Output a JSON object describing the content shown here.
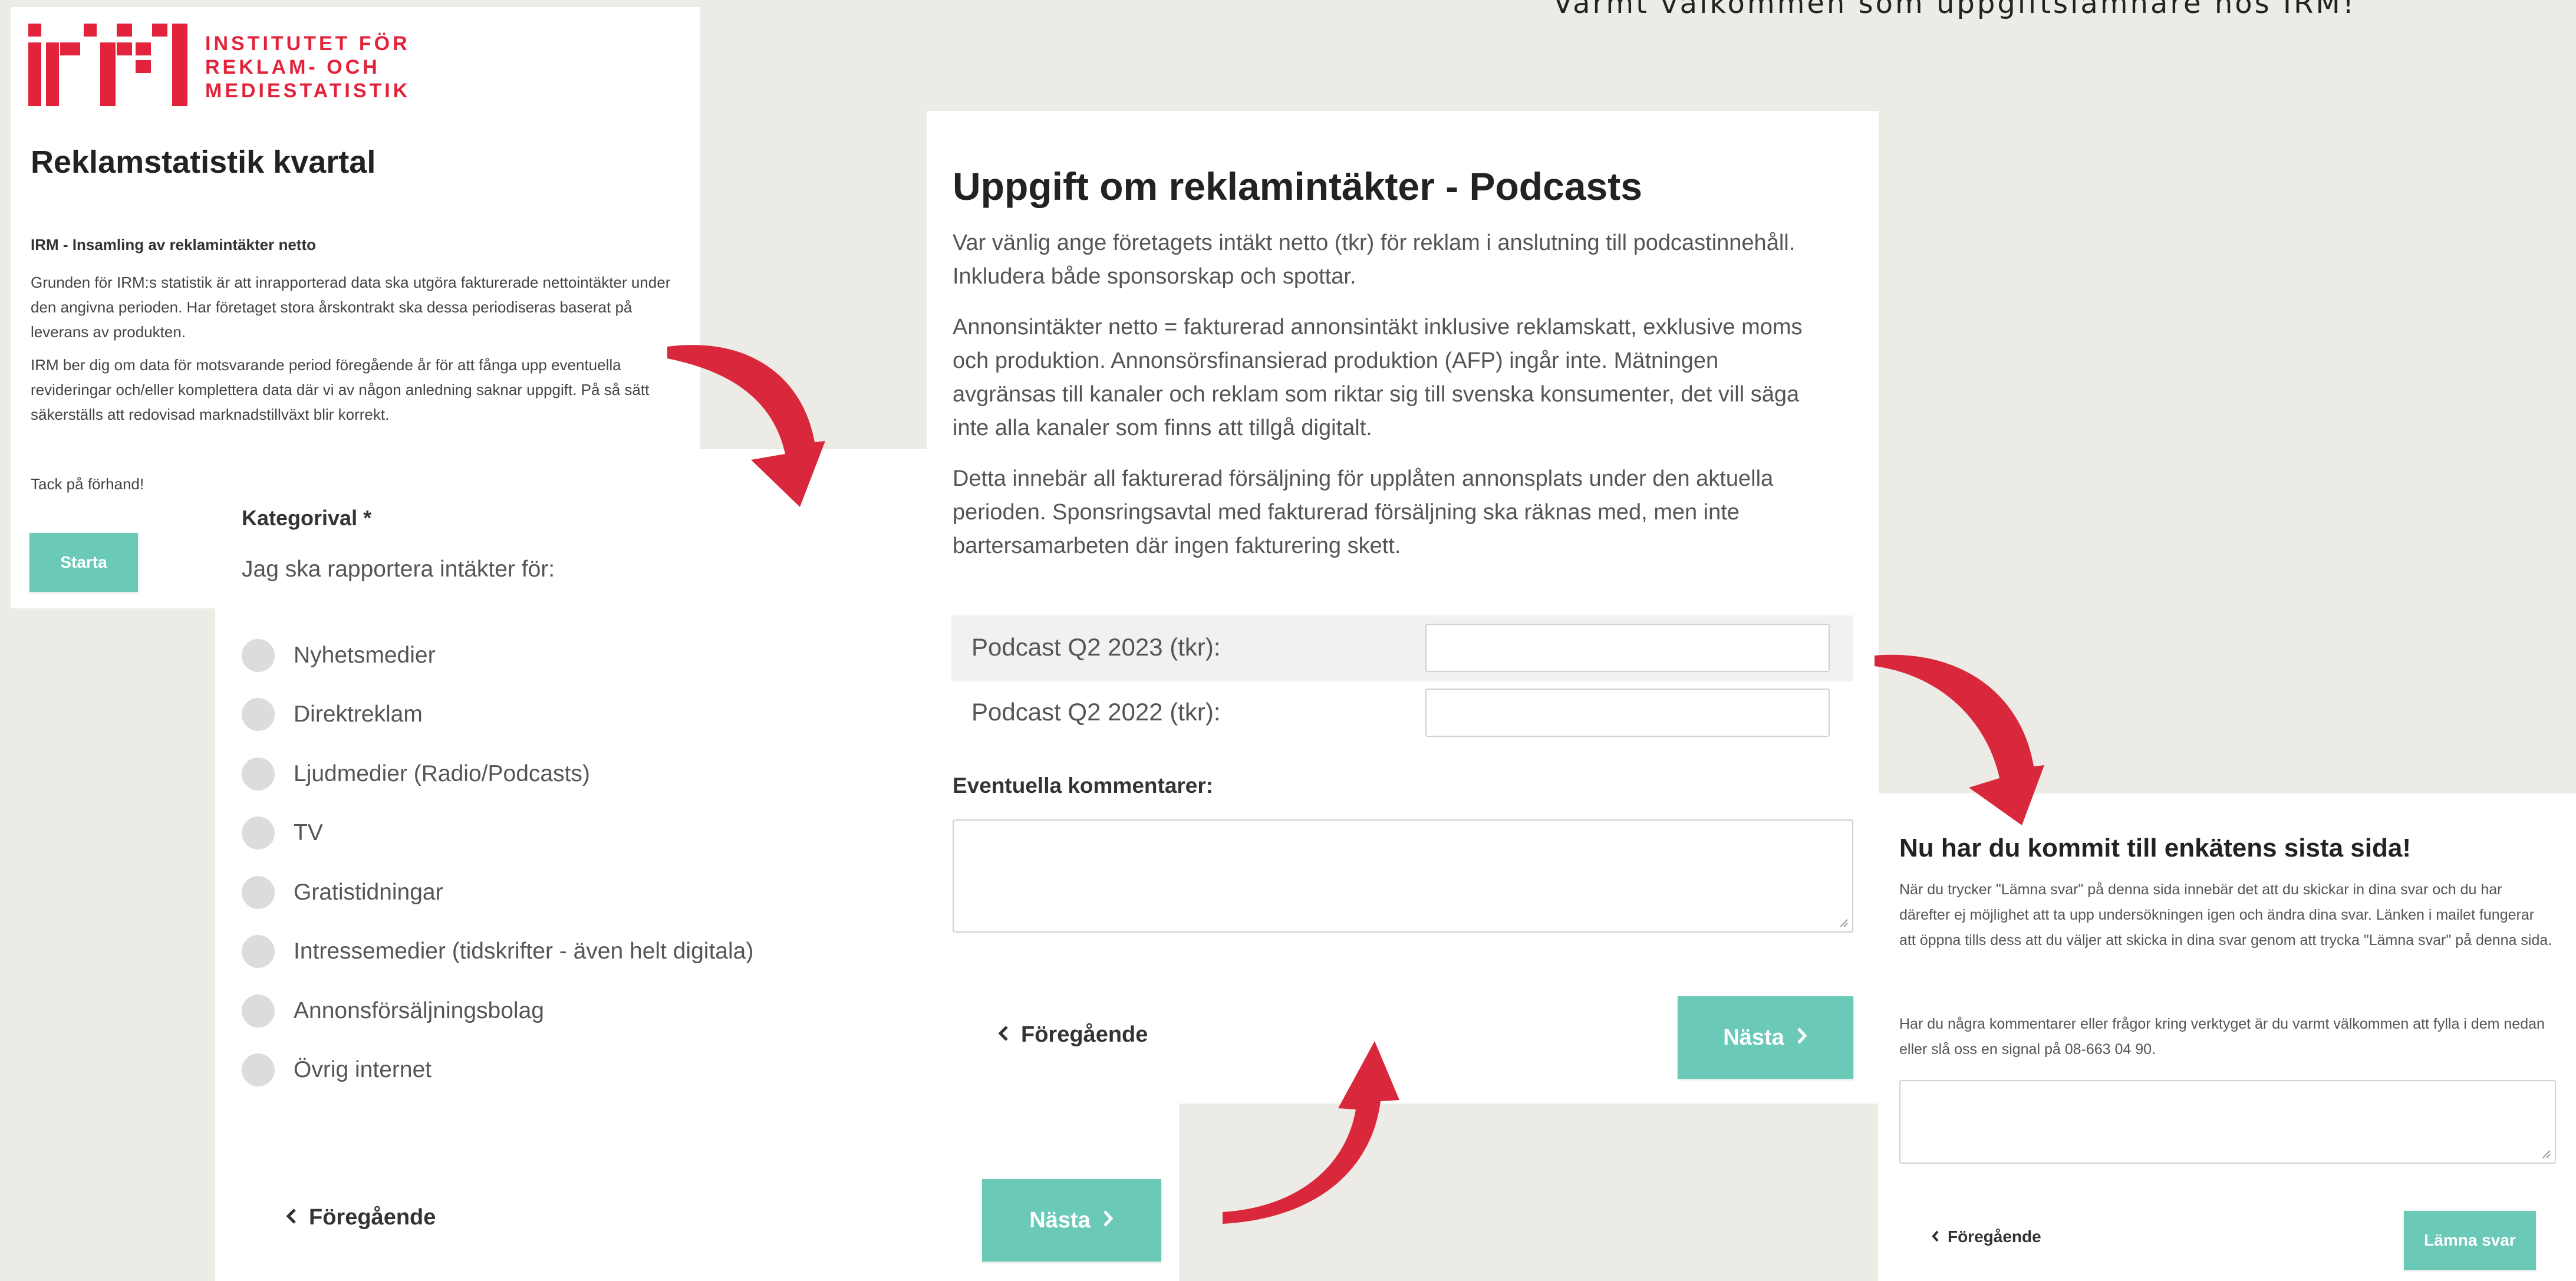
{
  "tagline": "Varmt välkommen som uppgiftslämnare hos IRM!",
  "colors": {
    "background": "#edebe6",
    "accent": "#6bc9b7",
    "brand_red": "#e2233b",
    "arrow_red": "#d9283c"
  },
  "intro": {
    "logo_text": [
      "INSTITUTET FÖR",
      "REKLAM- OCH",
      "MEDIESTATISTIK"
    ],
    "logo_mark": "irm",
    "title": "Reklamstatistik kvartal",
    "subtitle": "IRM - Insamling av reklamintäkter netto",
    "para1": "Grunden för IRM:s statistik är att inrapporterad data ska utgöra fakturerade nettointäkter under den angivna perioden. Har företaget stora årskontrakt ska dessa periodiseras baserat på leverans av produkten.",
    "para2": "IRM ber dig om data för motsvarande period föregående år för att fånga upp eventuella revideringar och/eller komplettera data där vi av någon anledning saknar uppgift. På så sätt säkerställs att redovisad marknadstillväxt blir korrekt.",
    "thanks": "Tack på förhand!",
    "start_label": "Starta"
  },
  "category": {
    "heading": "Kategorival *",
    "question": "Jag ska rapportera intäkter för:",
    "options": [
      "Nyhetsmedier",
      "Direktreklam",
      "Ljudmedier (Radio/Podcasts)",
      "TV",
      "Gratistidningar",
      "Intressemedier (tidskrifter - även helt digitala)",
      "Annonsförsäljningsbolag",
      "Övrig internet"
    ],
    "prev_label": "Föregående",
    "next_label": "Nästa"
  },
  "podcast": {
    "title": "Uppgift om reklamintäkter - Podcasts",
    "p1": "Var vänlig ange företagets intäkt netto (tkr) för reklam i anslutning till podcastinnehåll. Inkludera både sponsorskap och spottar.",
    "p2": "Annonsintäkter netto = fakturerad annonsintäkt inklusive reklamskatt, exklusive moms och produktion. Annonsörsfinansierad produktion (AFP) ingår inte. Mätningen avgränsas till kanaler och reklam som riktar sig till svenska konsumenter, det vill säga inte alla kanaler som finns att tillgå digitalt.",
    "p3": "Detta innebär all fakturerad försäljning för upplåten annonsplats under den aktuella perioden. Sponsringsavtal med fakturerad försäljning ska räknas med, men inte bartersamarbeten där ingen fakturering skett.",
    "field1_label": "Podcast Q2 2023 (tkr):",
    "field2_label": "Podcast Q2 2022 (tkr):",
    "comments_label": "Eventuella kommentarer:",
    "prev_label": "Föregående",
    "next_label": "Nästa"
  },
  "final": {
    "title": "Nu har du kommit till enkätens sista sida!",
    "p1": "När du trycker \"Lämna svar\" på denna sida innebär det att du skickar in dina svar och du har därefter ej möjlighet att ta upp undersökningen igen och ändra dina svar. Länken i mailet fungerar att öppna tills dess att du väljer att skicka in dina svar genom att trycka \"Lämna svar\" på denna sida.",
    "p2": "Har du några kommentarer eller frågor kring verktyget är du varmt välkommen att fylla i dem nedan eller slå oss en signal på 08-663 04 90.",
    "prev_label": "Föregående",
    "submit_label": "Lämna svar"
  }
}
